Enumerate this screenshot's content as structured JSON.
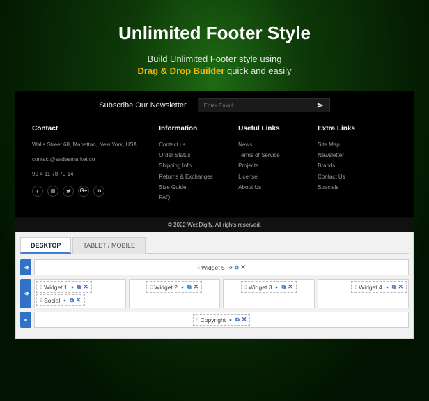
{
  "hero": {
    "title": "Unlimited Footer Style",
    "sub1": "Build Unlimited Footer style using",
    "accent": "Drag & Drop Builder",
    "sub2_tail": " quick and easily"
  },
  "newsletter": {
    "label": "Subscribe Our Newsletter",
    "placeholder": "Enter Email...."
  },
  "footer_cols": {
    "contact": {
      "title": "Contact",
      "address": "Walls Street 68, Mahattan, New York, USA",
      "email": "contact@sadesmarket.co",
      "phone": "99 4 11 78 70 14"
    },
    "info": {
      "title": "Information",
      "items": [
        "Contact us",
        "Order Status",
        "Shipping Info",
        "Returns & Exchanges",
        "Size Guide",
        "FAQ"
      ]
    },
    "useful": {
      "title": "Useful Links",
      "items": [
        "News",
        "Terms of Service",
        "Projects",
        "License",
        "About Us"
      ]
    },
    "extra": {
      "title": "Extra Links",
      "items": [
        "Site Map",
        "Newsletter",
        "Brands",
        "Contact Us",
        "Specials"
      ]
    }
  },
  "copyright": "© 2022 WebDigify. All rights reserved.",
  "builder": {
    "tabs": {
      "desktop": "DESKTOP",
      "tablet": "TABLET / MOBILE"
    },
    "widgets": {
      "w5": "Widget 5",
      "w1": "Widget 1",
      "social": "Social",
      "w2": "Widget 2",
      "w3": "Widget 3",
      "w4": "Widget 4",
      "copyright": "Copyright"
    }
  }
}
